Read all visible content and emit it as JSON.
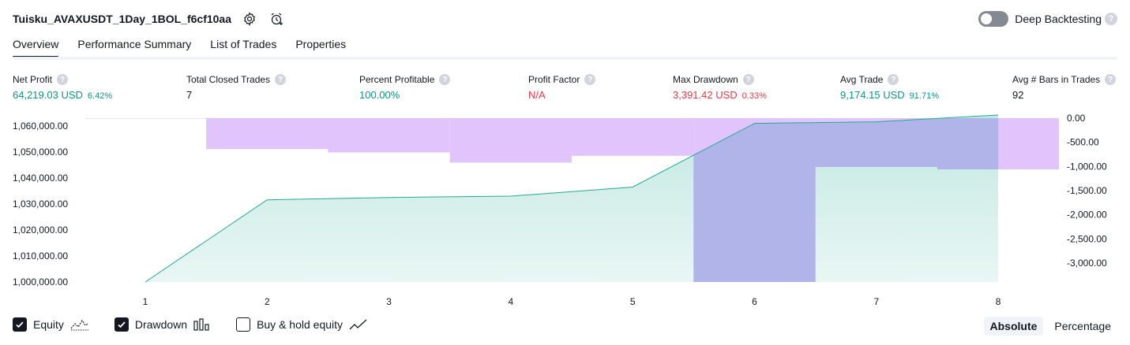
{
  "header": {
    "title": "Tuisku_AVAXUSDT_1Day_1BOL_f6cf10aa",
    "deep_backtesting_label": "Deep Backtesting",
    "help_glyph": "?"
  },
  "tabs": [
    {
      "label": "Overview",
      "active": true
    },
    {
      "label": "Performance Summary",
      "active": false
    },
    {
      "label": "List of Trades",
      "active": false
    },
    {
      "label": "Properties",
      "active": false
    }
  ],
  "metrics": [
    {
      "label": "Net Profit",
      "value": "64,219.03 USD",
      "pct": "6.42%",
      "tone": "pos"
    },
    {
      "label": "Total Closed Trades",
      "value": "7",
      "pct": "",
      "tone": "neu"
    },
    {
      "label": "Percent Profitable",
      "value": "100.00%",
      "pct": "",
      "tone": "pos"
    },
    {
      "label": "Profit Factor",
      "value": "N/A",
      "pct": "",
      "tone": "neg"
    },
    {
      "label": "Max Drawdown",
      "value": "3,391.42 USD",
      "pct": "0.33%",
      "tone": "neg"
    },
    {
      "label": "Avg Trade",
      "value": "9,174.15 USD",
      "pct": "91.71%",
      "tone": "pos"
    },
    {
      "label": "Avg # Bars in Trades",
      "value": "92",
      "pct": "",
      "tone": "neu"
    }
  ],
  "chart_data": {
    "type": "area",
    "x": [
      1,
      2,
      3,
      4,
      5,
      6,
      7,
      8
    ],
    "xticks": [
      "1",
      "2",
      "3",
      "4",
      "5",
      "6",
      "7",
      "8"
    ],
    "left_axis": {
      "ticks": [
        "1,000,000.00",
        "1,010,000.00",
        "1,020,000.00",
        "1,030,000.00",
        "1,040,000.00",
        "1,050,000.00",
        "1,060,000.00"
      ],
      "range": [
        1000000,
        1063000
      ]
    },
    "right_axis": {
      "ticks": [
        "0.00",
        "-500.00",
        "-1,000.00",
        "-1,500.00",
        "-2,000.00",
        "-2,500.00",
        "-3,000.00"
      ],
      "range": [
        0,
        -3391.42
      ]
    },
    "series": [
      {
        "name": "Equity",
        "axis": "left",
        "color": "#22ab94",
        "values": [
          1000000,
          1031600,
          1032500,
          1033000,
          1036500,
          1061000,
          1061600,
          1064219.03
        ]
      },
      {
        "name": "Drawdown",
        "axis": "right",
        "color": "#e1c4fb",
        "values": [
          0,
          -640,
          -710,
          -920,
          -780,
          -3391.42,
          -1010,
          -1060
        ]
      }
    ],
    "overlap_color": "#b0b4e8"
  },
  "legend": [
    {
      "label": "Equity",
      "checked": true,
      "icon": "equity-line-icon"
    },
    {
      "label": "Drawdown",
      "checked": true,
      "icon": "drawdown-bars-icon"
    },
    {
      "label": "Buy & hold equity",
      "checked": false,
      "icon": "buy-hold-line-icon"
    }
  ],
  "modes": [
    {
      "label": "Absolute",
      "active": true
    },
    {
      "label": "Percentage",
      "active": false
    }
  ],
  "colors": {
    "positive": "#089981",
    "negative": "#f23645",
    "equity_line": "#22ab94",
    "drawdown": "#e1c4fb"
  }
}
